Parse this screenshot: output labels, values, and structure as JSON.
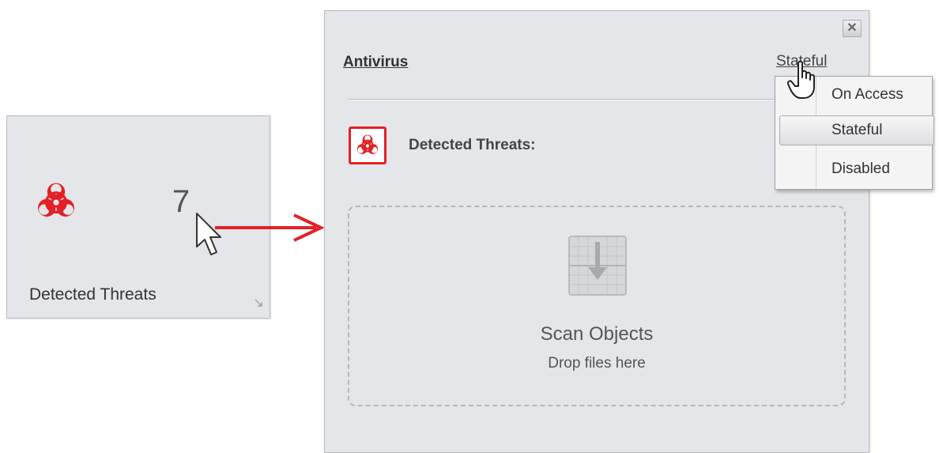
{
  "tile": {
    "count": "7",
    "label": "Detected Threats",
    "icon": "biohazard-icon",
    "accent_color": "#e32026"
  },
  "panel": {
    "title": "Antivirus",
    "mode_link": "Stateful",
    "close_icon": "close-icon",
    "threats_heading": "Detected Threats:",
    "scan_title": "Scan Objects",
    "scan_subtitle": "Drop files here"
  },
  "menu": {
    "items": [
      {
        "label": "On Access"
      },
      {
        "label": "Stateful",
        "selected": true
      },
      {
        "label": "Disabled"
      }
    ]
  }
}
